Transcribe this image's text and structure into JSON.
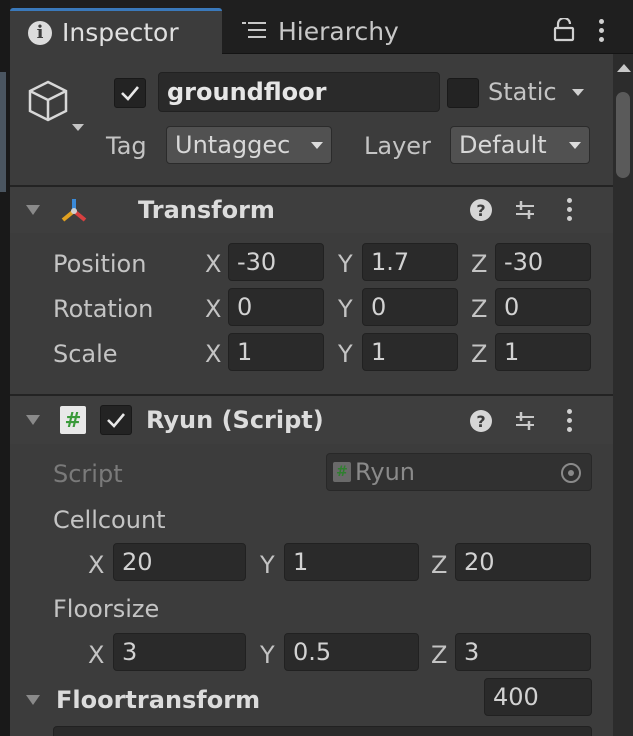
{
  "tabs": {
    "inspector": "Inspector",
    "hierarchy": "Hierarchy"
  },
  "object": {
    "name": "groundfloor",
    "active": true,
    "static_label": "Static",
    "static": false,
    "tag_label": "Tag",
    "tag_value": "Untaggec",
    "layer_label": "Layer",
    "layer_value": "Default"
  },
  "transform": {
    "title": "Transform",
    "rows": [
      {
        "label": "Position",
        "x": "-30",
        "y": "1.7",
        "z": "-30"
      },
      {
        "label": "Rotation",
        "x": "0",
        "y": "0",
        "z": "0"
      },
      {
        "label": "Scale",
        "x": "1",
        "y": "1",
        "z": "1"
      }
    ]
  },
  "axis": {
    "x": "X",
    "y": "Y",
    "z": "Z"
  },
  "script_component": {
    "title": "Ryun (Script)",
    "enabled": true,
    "script_label": "Script",
    "script_value": "Ryun",
    "cellcount": {
      "label": "Cellcount",
      "x": "20",
      "y": "1",
      "z": "20"
    },
    "floorsize": {
      "label": "Floorsize",
      "x": "3",
      "y": "0.5",
      "z": "3"
    },
    "floortransform": {
      "label": "Floortransform",
      "size": "400"
    }
  },
  "colors": {
    "panel": "#3c3c3c",
    "field": "#2a2a2a",
    "accent_tab": "#3a79bb",
    "script_icon_green": "#3a9a3a"
  }
}
